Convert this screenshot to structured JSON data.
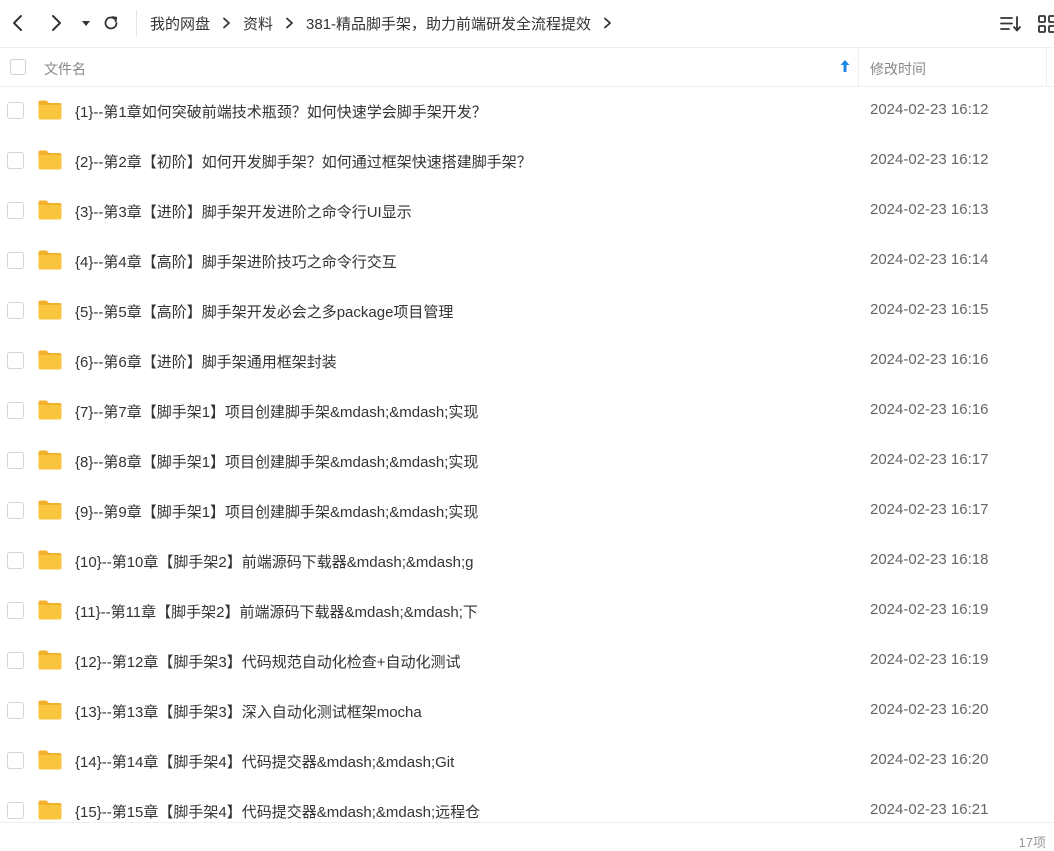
{
  "toolbar": {
    "back_icon": "chevron-left-icon",
    "forward_icon": "chevron-right-icon",
    "history_icon": "caret-down-icon",
    "refresh_icon": "refresh-icon",
    "breadcrumbs": [
      "我的网盘",
      "资料",
      "381-精品脚手架，助力前端研发全流程提效"
    ],
    "sort_icon": "sort-list-icon",
    "view_icon": "grid-view-icon"
  },
  "header": {
    "name_label": "文件名",
    "time_label": "修改时间",
    "sort_arrow": "↑"
  },
  "files": [
    {
      "name": "{1}--第1章如何突破前端技术瓶颈？如何快速学会脚手架开发？",
      "time": "2024-02-23 16:12"
    },
    {
      "name": "{2}--第2章【初阶】如何开发脚手架？如何通过框架快速搭建脚手架？",
      "time": "2024-02-23 16:12"
    },
    {
      "name": "{3}--第3章【进阶】脚手架开发进阶之命令行UI显示",
      "time": "2024-02-23 16:13"
    },
    {
      "name": "{4}--第4章【高阶】脚手架进阶技巧之命令行交互",
      "time": "2024-02-23 16:14"
    },
    {
      "name": "{5}--第5章【高阶】脚手架开发必会之多package项目管理",
      "time": "2024-02-23 16:15"
    },
    {
      "name": "{6}--第6章【进阶】脚手架通用框架封装",
      "time": "2024-02-23 16:16"
    },
    {
      "name": "{7}--第7章【脚手架1】项目创建脚手架&mdash;&mdash;实现",
      "time": "2024-02-23 16:16"
    },
    {
      "name": "{8}--第8章【脚手架1】项目创建脚手架&mdash;&mdash;实现",
      "time": "2024-02-23 16:17"
    },
    {
      "name": "{9}--第9章【脚手架1】项目创建脚手架&mdash;&mdash;实现",
      "time": "2024-02-23 16:17"
    },
    {
      "name": "{10}--第10章【脚手架2】前端源码下载器&mdash;&mdash;g",
      "time": "2024-02-23 16:18"
    },
    {
      "name": "{11}--第11章【脚手架2】前端源码下载器&mdash;&mdash;下",
      "time": "2024-02-23 16:19"
    },
    {
      "name": "{12}--第12章【脚手架3】代码规范自动化检查+自动化测试",
      "time": "2024-02-23 16:19"
    },
    {
      "name": "{13}--第13章【脚手架3】深入自动化测试框架mocha",
      "time": "2024-02-23 16:20"
    },
    {
      "name": "{14}--第14章【脚手架4】代码提交器&mdash;&mdash;Git",
      "time": "2024-02-23 16:20"
    },
    {
      "name": "{15}--第15章【脚手架4】代码提交器&mdash;&mdash;远程仓",
      "time": "2024-02-23 16:21"
    }
  ],
  "footer": {
    "count_label": "17项"
  },
  "colors": {
    "folder": "#F9C43E",
    "folder_tab": "#F2B12B",
    "sort_arrow": "#1E88E5"
  }
}
